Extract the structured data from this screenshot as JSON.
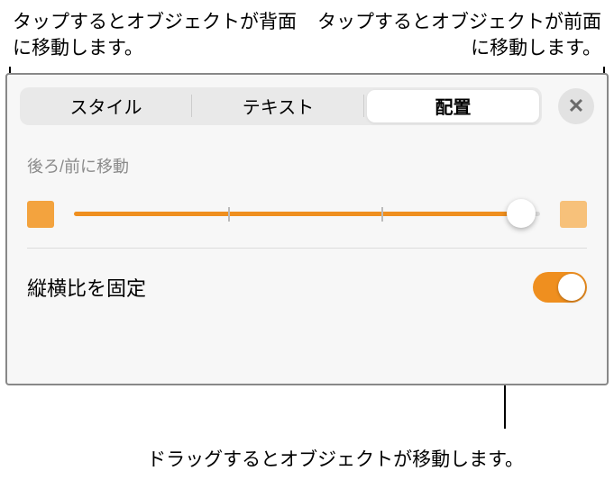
{
  "callouts": {
    "top_left": "タップするとオブジェクトが背面に移動します。",
    "top_right": "タップするとオブジェクトが前面に移動します。",
    "bottom": "ドラッグするとオブジェクトが移動します。"
  },
  "tabs": {
    "style": "スタイル",
    "text": "テキスト",
    "arrange": "配置"
  },
  "section": {
    "move_label": "後ろ/前に移動"
  },
  "toggle": {
    "lock_aspect": "縦横比を固定"
  },
  "icons": {
    "close": "✕"
  },
  "colors": {
    "accent": "#ef8f1f"
  }
}
